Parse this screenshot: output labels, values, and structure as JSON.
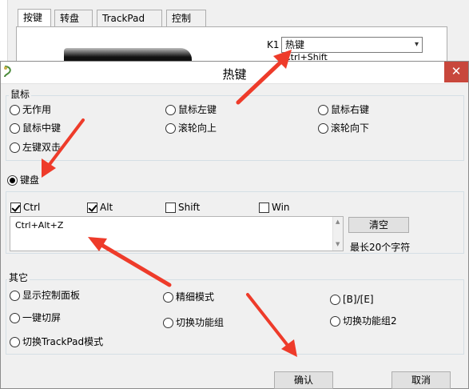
{
  "background_window": {
    "tabs": [
      "按键",
      "转盘",
      "TrackPad",
      "控制"
    ],
    "k1_label": "K1",
    "k1_value": "热键",
    "k1_hint": "Ctrl+Shift"
  },
  "dialog": {
    "title": "热键",
    "close_symbol": "✕",
    "mouse_group": {
      "title": "鼠标",
      "options": [
        "无作用",
        "鼠标左键",
        "鼠标右键",
        "鼠标中键",
        "滚轮向上",
        "滚轮向下",
        "左键双击"
      ]
    },
    "keyboard": {
      "label": "键盘",
      "modifiers": [
        {
          "label": "Ctrl",
          "checked": true
        },
        {
          "label": "Alt",
          "checked": true
        },
        {
          "label": "Shift",
          "checked": false
        },
        {
          "label": "Win",
          "checked": false
        }
      ],
      "hotkey_value": "Ctrl+Alt+Z",
      "clear_label": "清空",
      "max_chars_label": "最长20个字符"
    },
    "other_group": {
      "title": "其它",
      "options": [
        "显示控制面板",
        "精细模式",
        "[B]/[E]",
        "一键切屏",
        "切换功能组",
        "切换功能组2",
        "切换TrackPad模式"
      ]
    },
    "ok_label": "确认",
    "cancel_label": "取消"
  },
  "colors": {
    "annotation_arrow": "#ee3b2a",
    "close_button": "#c8473c"
  }
}
